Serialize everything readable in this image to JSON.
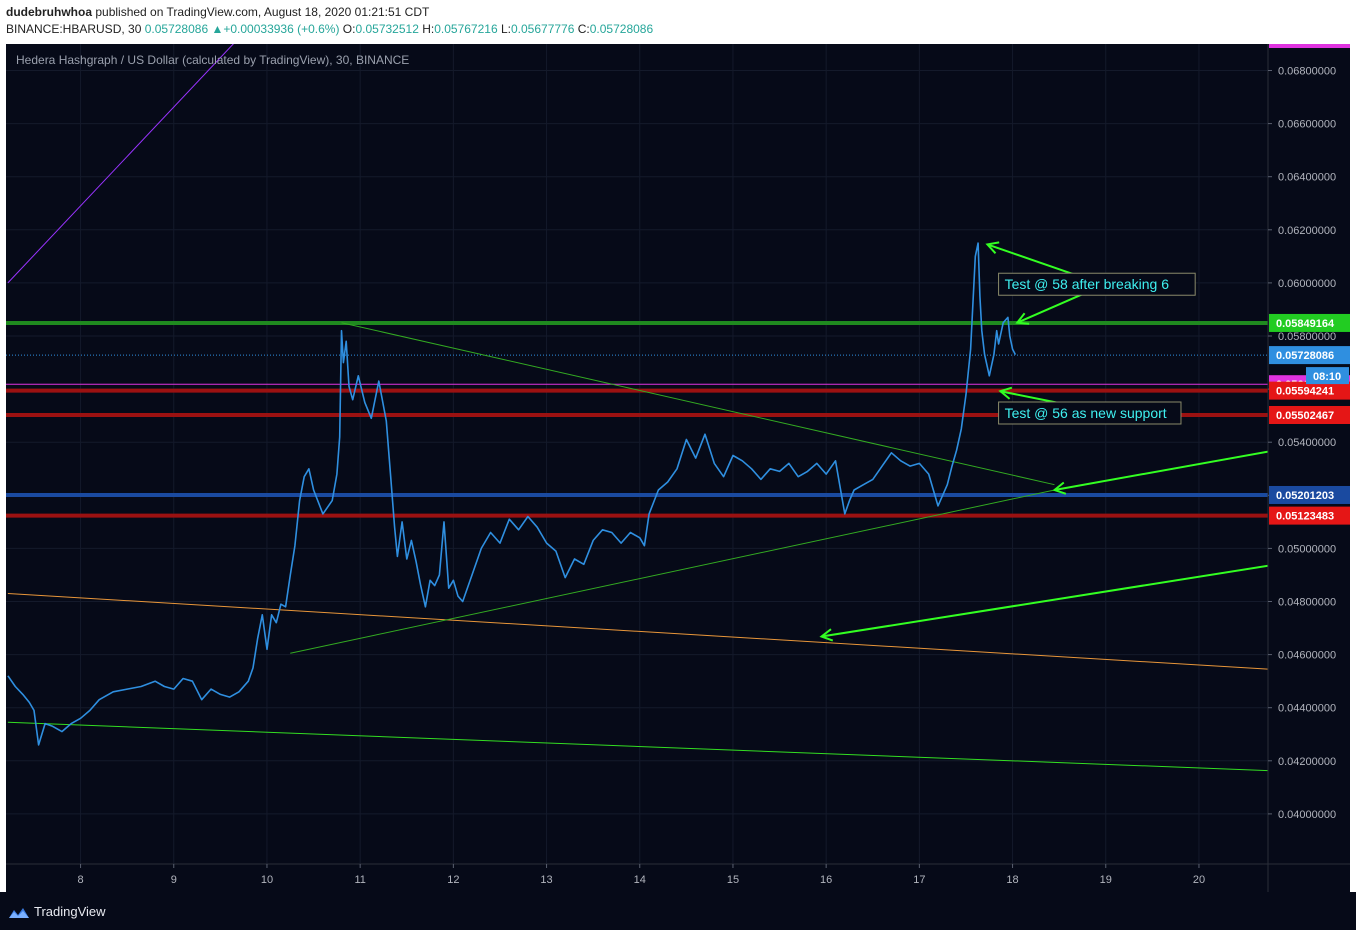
{
  "header": {
    "author": "dudebruhwhoa",
    "published_text": "published on TradingView.com, August 18, 2020 01:21:51 CDT",
    "symbol": "BINANCE:HBARUSD, 30",
    "last": "0.05728086",
    "change_arrow": "▲",
    "change": "+0.00033936 (+0.6%)",
    "o_label": "O:",
    "o": "0.05732512",
    "h_label": "H:",
    "h": "0.05767216",
    "l_label": "L:",
    "l": "0.05677776",
    "c_label": "C:",
    "c": "0.05728086"
  },
  "footer": {
    "logo_text": "TradingView"
  },
  "colors": {
    "background": "#060a18",
    "price_line": "#2f8fe0",
    "green_level": "#1f8a1f",
    "red_level": "#9b1111",
    "blue_level": "#1a4aa0",
    "magenta": "#e033e0",
    "annotation_green": "#33ff22",
    "annotation_text": "#3ff0f0",
    "orange_trend": "#e8963a",
    "purple_trend": "#9933ff"
  },
  "chart_data": {
    "type": "line",
    "title": "Hedera Hashgraph / US Dollar (calculated by TradingView), 30, BINANCE",
    "xlabel": "",
    "ylabel": "",
    "x_ticks": [
      "8",
      "9",
      "10",
      "11",
      "12",
      "13",
      "14",
      "15",
      "16",
      "17",
      "18",
      "19",
      "20"
    ],
    "y_ticks": [
      "0.04000000",
      "0.04200000",
      "0.04400000",
      "0.04600000",
      "0.04800000",
      "0.05000000",
      "0.05200000",
      "0.05400000",
      "0.05600000",
      "0.05800000",
      "0.06000000",
      "0.06200000",
      "0.06400000",
      "0.06600000",
      "0.06800000"
    ],
    "ylim": [
      0.0385,
      0.0695
    ],
    "xlim": [
      7.2,
      20.75
    ],
    "grid": true,
    "series": [
      {
        "style": "line",
        "x": [
          7.22,
          7.3,
          7.38,
          7.45,
          7.5,
          7.55,
          7.62,
          7.7,
          7.8,
          7.9,
          8.0,
          8.1,
          8.2,
          8.35,
          8.5,
          8.65,
          8.8,
          8.9,
          9.0,
          9.1,
          9.2,
          9.3,
          9.4,
          9.5,
          9.6,
          9.7,
          9.8,
          9.85,
          9.9,
          9.95,
          10.0,
          10.05,
          10.1,
          10.15,
          10.2,
          10.25,
          10.3,
          10.35,
          10.4,
          10.45,
          10.5,
          10.6,
          10.7,
          10.75,
          10.78,
          10.8,
          10.82,
          10.85,
          10.88,
          10.92,
          10.98,
          11.05,
          11.12,
          11.2,
          11.28,
          11.33,
          11.37,
          11.4,
          11.45,
          11.5,
          11.55,
          11.6,
          11.65,
          11.7,
          11.75,
          11.8,
          11.85,
          11.9,
          11.95,
          12.0,
          12.05,
          12.1,
          12.2,
          12.3,
          12.4,
          12.5,
          12.6,
          12.7,
          12.8,
          12.9,
          13.0,
          13.1,
          13.2,
          13.3,
          13.4,
          13.5,
          13.6,
          13.7,
          13.8,
          13.9,
          14.0,
          14.05,
          14.1,
          14.2,
          14.3,
          14.4,
          14.5,
          14.6,
          14.7,
          14.8,
          14.9,
          15.0,
          15.1,
          15.2,
          15.3,
          15.4,
          15.5,
          15.6,
          15.7,
          15.8,
          15.9,
          16.0,
          16.1,
          16.2,
          16.25,
          16.3,
          16.4,
          16.5,
          16.6,
          16.7,
          16.8,
          16.9,
          17.0,
          17.1,
          17.2,
          17.3,
          17.35,
          17.4,
          17.45,
          17.5,
          17.55,
          17.6,
          17.63,
          17.65,
          17.67,
          17.7,
          17.75,
          17.8,
          17.83,
          17.85,
          17.9,
          17.95,
          17.97,
          18.0,
          18.03
        ],
        "y": [
          0.0452,
          0.0448,
          0.0445,
          0.0442,
          0.0439,
          0.0426,
          0.0434,
          0.0433,
          0.0431,
          0.0434,
          0.0436,
          0.0439,
          0.0443,
          0.0446,
          0.0447,
          0.0448,
          0.045,
          0.0448,
          0.0447,
          0.0451,
          0.045,
          0.0443,
          0.0447,
          0.0445,
          0.0444,
          0.0446,
          0.045,
          0.0455,
          0.0466,
          0.0475,
          0.0462,
          0.0475,
          0.0472,
          0.0479,
          0.0478,
          0.049,
          0.0501,
          0.0518,
          0.0527,
          0.053,
          0.0522,
          0.0513,
          0.0518,
          0.0528,
          0.0542,
          0.0582,
          0.057,
          0.0578,
          0.0561,
          0.0556,
          0.0565,
          0.0555,
          0.0549,
          0.0563,
          0.0548,
          0.0526,
          0.0508,
          0.0497,
          0.051,
          0.0496,
          0.0503,
          0.0495,
          0.0486,
          0.0478,
          0.0488,
          0.0486,
          0.049,
          0.051,
          0.0485,
          0.0488,
          0.0482,
          0.048,
          0.049,
          0.05,
          0.0506,
          0.0502,
          0.0511,
          0.0507,
          0.0512,
          0.0508,
          0.0502,
          0.0499,
          0.0489,
          0.0496,
          0.0494,
          0.0503,
          0.0507,
          0.0506,
          0.0502,
          0.0506,
          0.0504,
          0.0501,
          0.0513,
          0.0522,
          0.0525,
          0.053,
          0.0541,
          0.0534,
          0.0543,
          0.0532,
          0.0527,
          0.0535,
          0.0533,
          0.053,
          0.0526,
          0.053,
          0.0529,
          0.0532,
          0.0527,
          0.0529,
          0.0532,
          0.0528,
          0.0533,
          0.0513,
          0.0518,
          0.0522,
          0.0524,
          0.0526,
          0.0531,
          0.0536,
          0.0533,
          0.0531,
          0.0532,
          0.0528,
          0.0516,
          0.0524,
          0.0531,
          0.0537,
          0.0545,
          0.0558,
          0.0575,
          0.061,
          0.0615,
          0.0595,
          0.0582,
          0.0573,
          0.0565,
          0.0573,
          0.0582,
          0.0577,
          0.0585,
          0.0587,
          0.058,
          0.0575,
          0.0573
        ]
      }
    ],
    "horizontal_levels": [
      {
        "value": 0.05849164,
        "label": "0.05849164",
        "color": "#1f8a1f",
        "tag_color": "#22cc22"
      },
      {
        "value": 0.05728086,
        "label": "0.05728086",
        "color": "#2f8fe0",
        "tag_color": "#2f8fe0",
        "dotted": true
      },
      {
        "value": 0.05618439,
        "label": "0.05618439",
        "color": "#e033e0",
        "tag_color": "#e033e0"
      },
      {
        "value": 0.05594241,
        "label": "0.05594241",
        "color": "#9b1111",
        "tag_color": "#e51616"
      },
      {
        "value": 0.05502467,
        "label": "0.05502467",
        "color": "#9b1111",
        "tag_color": "#e51616"
      },
      {
        "value": 0.05201203,
        "label": "0.05201203",
        "color": "#1a4aa0",
        "tag_color": "#1a4aa0"
      },
      {
        "value": 0.05123483,
        "label": "0.05123483",
        "color": "#9b1111",
        "tag_color": "#e51616"
      }
    ],
    "countdown_label": "08:10",
    "trend_lines": [
      {
        "name": "purple",
        "x1": 7.22,
        "y1": 0.06,
        "x2": 9.8,
        "y2": 0.0696,
        "color": "#9933ff",
        "width": 1
      },
      {
        "name": "orange",
        "x1": 7.22,
        "y1": 0.0483,
        "x2": 20.75,
        "y2": 0.04545,
        "color": "#e8963a",
        "width": 1
      },
      {
        "name": "green-lower",
        "x1": 7.22,
        "y1": 0.04345,
        "x2": 20.75,
        "y2": 0.04163,
        "color": "#33dd22",
        "width": 1
      },
      {
        "name": "green-resistance",
        "x1": 10.8,
        "y1": 0.0585,
        "x2": 18.45,
        "y2": 0.0524,
        "color": "#33aa22",
        "width": 1
      },
      {
        "name": "green-support",
        "x1": 10.25,
        "y1": 0.04605,
        "x2": 18.45,
        "y2": 0.0522,
        "color": "#33aa22",
        "width": 1
      }
    ],
    "arrows": [
      {
        "from_x": 20.75,
        "from_y": 0.05365,
        "to_x": 18.45,
        "to_y": 0.0522
      },
      {
        "from_x": 20.75,
        "from_y": 0.04935,
        "to_x": 15.95,
        "to_y": 0.04668
      },
      {
        "from_x": 18.8,
        "from_y": 0.06015,
        "to_x": 17.73,
        "to_y": 0.06145
      },
      {
        "from_x": 18.8,
        "from_y": 0.05965,
        "to_x": 18.05,
        "to_y": 0.0585
      },
      {
        "from_x": 18.92,
        "from_y": 0.05518,
        "to_x": 17.87,
        "to_y": 0.05592
      }
    ],
    "annotations": [
      {
        "text": "Test @ 58 after breaking 6",
        "x": 17.85,
        "y": 0.05995
      },
      {
        "text": "Test @ 56 as new support",
        "x": 17.85,
        "y": 0.0551
      }
    ]
  }
}
